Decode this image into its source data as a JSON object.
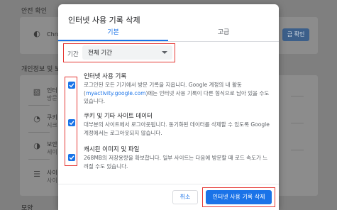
{
  "background": {
    "section_security": "안전 확인",
    "security_row": {
      "text": "Chro",
      "button": "금 확인"
    },
    "section_privacy": "개인정보 및 보",
    "rows": [
      {
        "title": "인터",
        "sub": "방문"
      },
      {
        "title": "쿠키",
        "sub": "시크"
      },
      {
        "title": "보안",
        "sub": "세이"
      },
      {
        "title": "사이",
        "sub": "사이"
      }
    ],
    "section_appearance": "모양"
  },
  "dialog": {
    "title": "인터넷 사용 기록 삭제",
    "tabs": [
      {
        "label": "기본",
        "selected": true
      },
      {
        "label": "고급",
        "selected": false
      }
    ],
    "time_range": {
      "label": "기간",
      "value": "전체 기간"
    },
    "items": [
      {
        "checked": true,
        "title": "인터넷 사용 기록",
        "desc_before_link": "로그인된 모든 기기에서 방문 기록을 지웁니다. Google 계정의 내 활동",
        "link": "myactivity.google.com",
        "desc_after_link": "에는 인터넷 사용 기록이 다른 형식으로 남아 있을 수도 있습니다."
      },
      {
        "checked": true,
        "title": "쿠키 및 기타 사이트 데이터",
        "desc": "대부분의 사이트에서 로그아웃됩니다. 동기화된 데이터를 삭제할 수 있도록 Google 계정에서는 로그아웃되지 않습니다."
      },
      {
        "checked": true,
        "title": "캐시된 이미지 및 파일",
        "desc": "268MB의 저장용량을 확보합니다. 일부 사이트는 다음에 방문할 때 로드 속도가 느려질 수도 있습니다."
      }
    ],
    "cancel_label": "취소",
    "confirm_label": "인터넷 사용 기록 삭제"
  },
  "colors": {
    "accent": "#1a73e8",
    "highlight": "#e53935"
  }
}
